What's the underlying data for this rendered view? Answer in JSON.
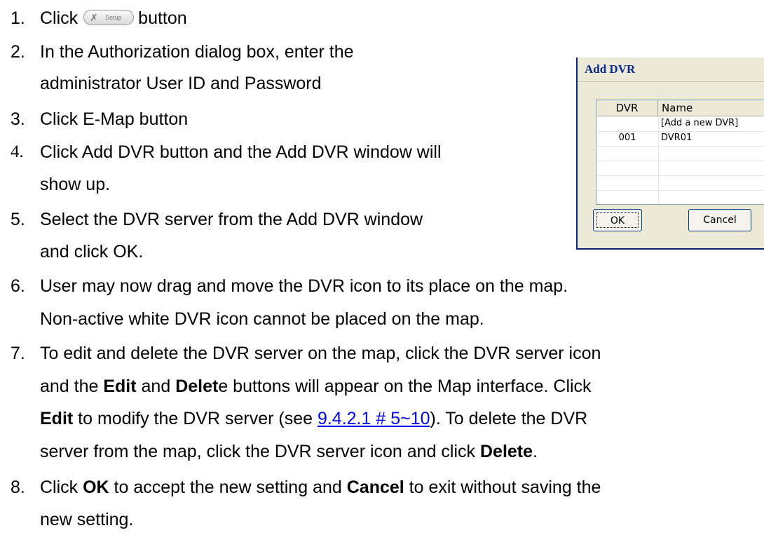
{
  "steps": [
    {
      "num": "1.",
      "pre": "Click",
      "button_label": "Setup",
      "post": "button"
    },
    {
      "num": "2.",
      "line1": "In the Authorization dialog box, enter the",
      "line2": "administrator User ID and Password"
    },
    {
      "num": "3.",
      "text": "Click E-Map button"
    },
    {
      "num": "4.",
      "line1": "Click Add DVR button and the Add DVR window will",
      "line2": "show up."
    },
    {
      "num": "5.",
      "line1": "Select the DVR server from the Add DVR window",
      "line2": "and click OK."
    },
    {
      "num": "6.",
      "line1": "User may now drag and move the DVR icon to its place on the map.",
      "line2": "Non-active white DVR icon cannot be placed on the map."
    },
    {
      "num": "7.",
      "line1": "To edit and delete the DVR server on the map, click the DVR server icon",
      "l2_a": "and the ",
      "l2_b": "Edit",
      "l2_c": " and ",
      "l2_d": "Delet",
      "l2_e": "e buttons will appear on the Map interface. Click",
      "l3_a": "Edit",
      "l3_b": " to modify the DVR server (see ",
      "l3_link": "9.4.2.1 # 5~10",
      "l3_c": "). To delete the DVR",
      "l4_a": "server from the map, click the DVR server icon and click ",
      "l4_b": "Delete",
      "l4_c": "."
    },
    {
      "num": "8.",
      "l1_a": "Click ",
      "l1_b": "OK",
      "l1_c": " to accept the new setting and ",
      "l1_d": "Cancel",
      "l1_e": " to exit without saving the",
      "line2": "new setting."
    }
  ],
  "dialog": {
    "title": "Add DVR",
    "columns": [
      "DVR",
      "Name"
    ],
    "rows": [
      {
        "dvr": "",
        "name": "[Add a new DVR]"
      },
      {
        "dvr": "001",
        "name": "DVR01"
      },
      {
        "dvr": "",
        "name": ""
      },
      {
        "dvr": "",
        "name": ""
      },
      {
        "dvr": "",
        "name": ""
      },
      {
        "dvr": "",
        "name": ""
      }
    ],
    "ok_label": "OK",
    "cancel_label": "Cancel"
  }
}
